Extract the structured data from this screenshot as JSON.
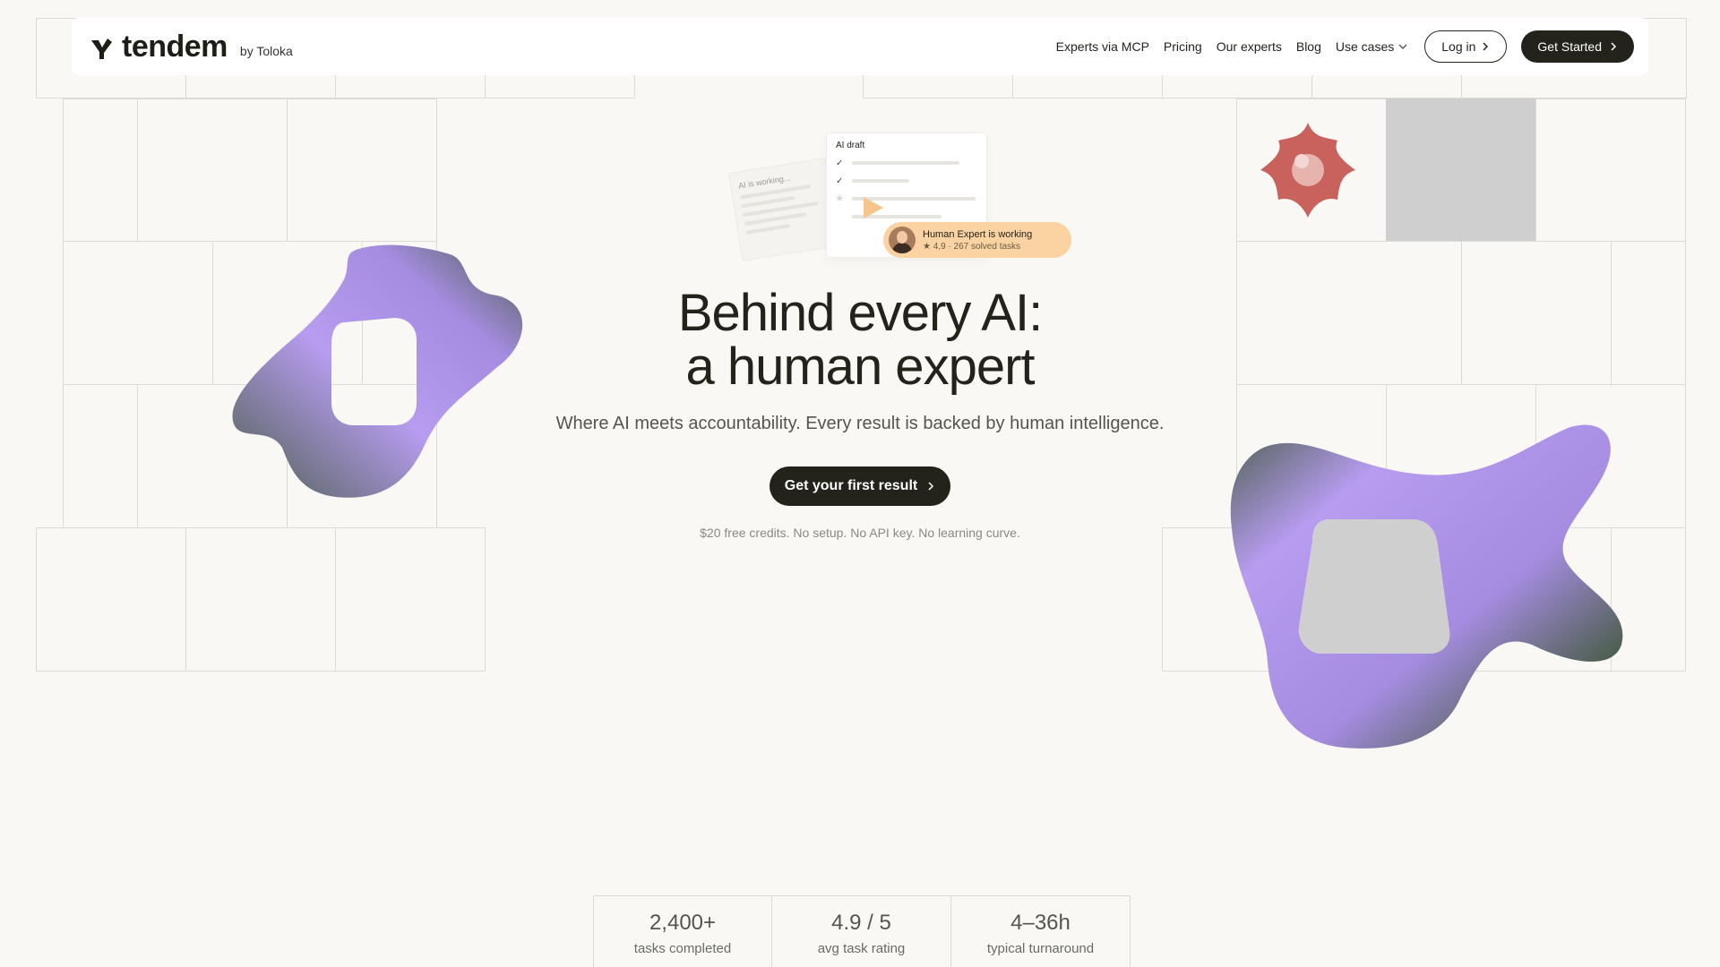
{
  "nav": {
    "brand_name": "tendem",
    "brand_by": "by Toloka",
    "links": [
      "Experts via MCP",
      "Pricing",
      "Our experts",
      "Blog"
    ],
    "use_cases_label": "Use cases",
    "login_label": "Log in",
    "get_started_label": "Get Started"
  },
  "illustration": {
    "ai_working_label": "AI is working...",
    "ai_draft_label": "AI draft",
    "expert_status": "Human Expert is working",
    "expert_rating": "4,9",
    "expert_tasks": "267 solved tasks"
  },
  "hero": {
    "title_line1": "Behind every AI:",
    "title_line2": "a human expert",
    "subtitle": "Where AI meets accountability. Every result is backed by human intelligence.",
    "cta_label": "Get your first result",
    "cta_note": "$20 free credits.  No setup. No API key. No learning curve."
  },
  "stats": [
    {
      "value": "2,400+",
      "label": "tasks completed"
    },
    {
      "value": "4.9 / 5",
      "label": "avg task rating"
    },
    {
      "value": "4–36h",
      "label": "typical turnaround"
    }
  ],
  "colors": {
    "background": "#f9f8f4",
    "dark": "#23231c",
    "blob_purple": "#b79cf0",
    "blob_green": "#4b5e4d",
    "expert_pill": "#fbd3a2"
  }
}
